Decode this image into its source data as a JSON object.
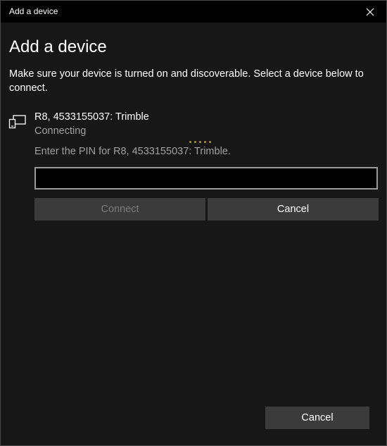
{
  "window": {
    "title": "Add a device"
  },
  "dialog": {
    "heading": "Add a device",
    "instructions": "Make sure your device is turned on and discoverable. Select a device below to connect."
  },
  "device": {
    "icon": "device-pair-icon",
    "name": "R8, 4533155037: Trimble",
    "status": "Connecting",
    "pin_prompt": "Enter the PIN for R8, 4533155037: Trimble.",
    "pin_value": "",
    "connect_label": "Connect",
    "connect_enabled": false,
    "cancel_label": "Cancel"
  },
  "footer": {
    "cancel_label": "Cancel"
  },
  "colors": {
    "background": "#171717",
    "titlebar": "#000000",
    "button": "#3b3b3b",
    "progress_dot": "#b58f2a",
    "secondary_text": "#a0a0a0"
  }
}
